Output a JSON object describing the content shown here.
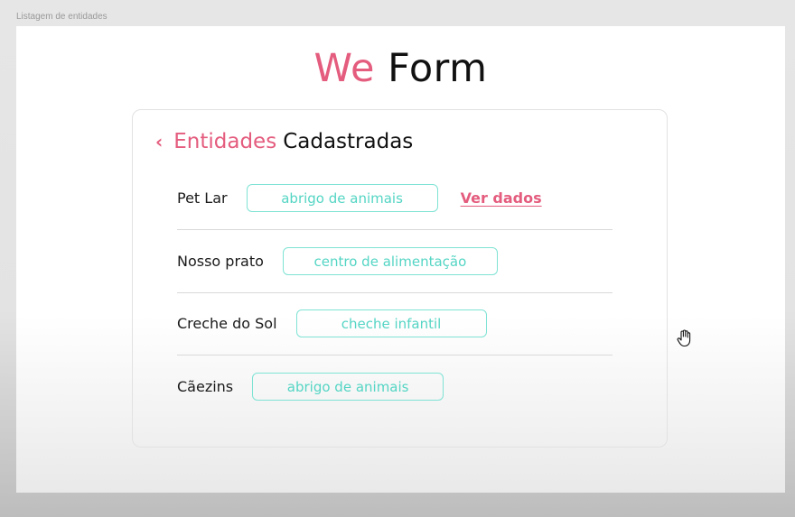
{
  "window": {
    "frame_label": "Listagem de entidades"
  },
  "brand": {
    "part1": "We",
    "part2": "Form"
  },
  "colors": {
    "accent": "#e45c7e",
    "tag": "#54d5c4",
    "tag_border": "#7fe3d4"
  },
  "card": {
    "back_icon": "chevron-left-icon",
    "title_accent": "Entidades",
    "title_rest": "Cadastradas"
  },
  "entities": [
    {
      "name": "Pet Lar",
      "tag": "abrigo de animais",
      "link": "Ver dados"
    },
    {
      "name": "Nosso prato",
      "tag": "centro de alimentação"
    },
    {
      "name": "Creche do Sol",
      "tag": "cheche infantil"
    },
    {
      "name": "Cãezins",
      "tag": "abrigo de animais"
    }
  ],
  "cursor": {
    "icon": "hand-cursor-icon"
  }
}
